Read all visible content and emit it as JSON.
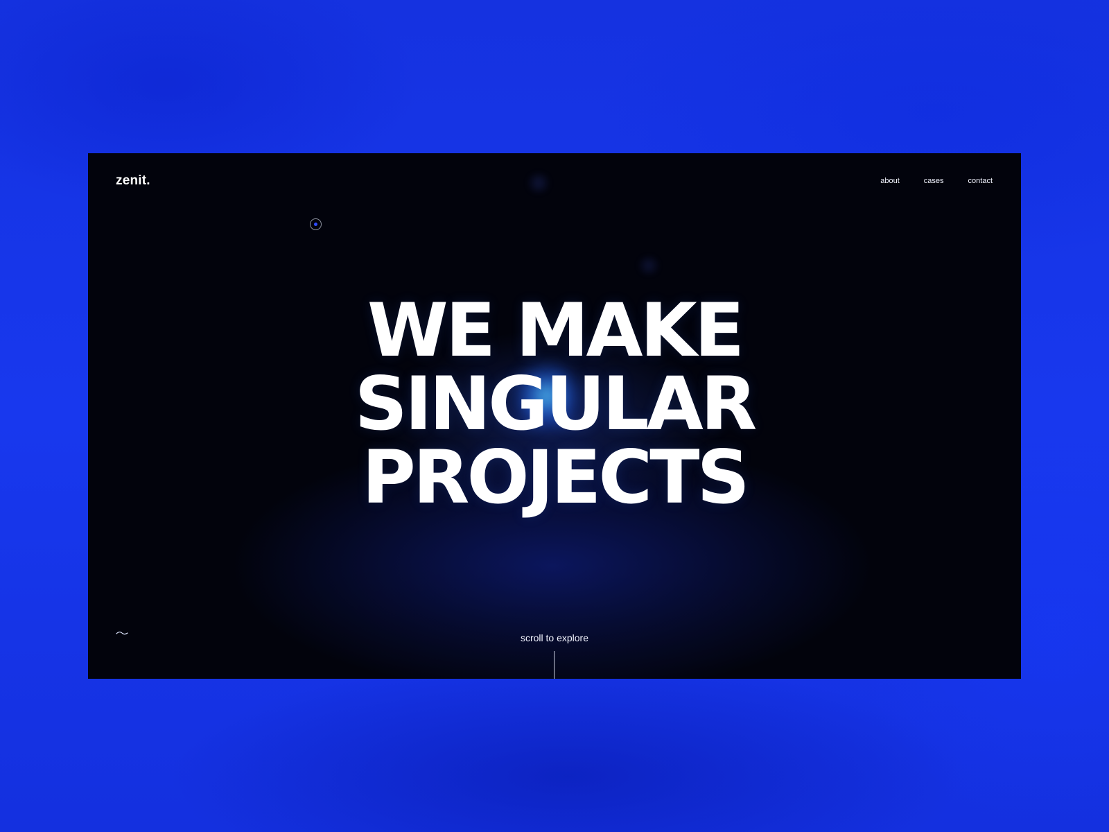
{
  "brand": {
    "logo": "zenit."
  },
  "nav": {
    "items": [
      {
        "label": "about"
      },
      {
        "label": "cases"
      },
      {
        "label": "contact"
      }
    ]
  },
  "hero": {
    "lines": [
      "WE MAKE",
      "SINGULAR",
      "PROJECTS"
    ]
  },
  "footer": {
    "scroll_label": "scroll to explore"
  },
  "icons": {
    "cursor": "cursor-ring-icon",
    "wave": "wave-icon"
  },
  "colors": {
    "backdrop": "#1634e8",
    "screen": "#02030c",
    "text": "#ffffff",
    "accent": "#2f4cff",
    "glow": "#5cd8ff"
  }
}
